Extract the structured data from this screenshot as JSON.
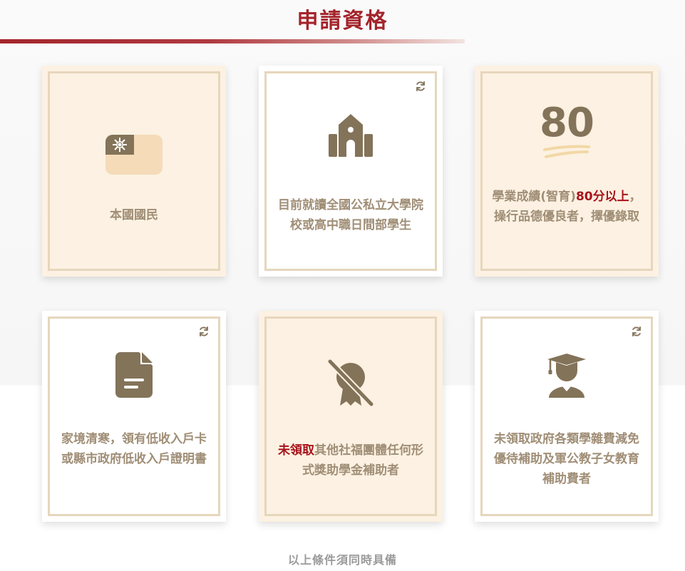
{
  "section": {
    "title": "申請資格",
    "footer_note": "以上條件須同時具備"
  },
  "colors": {
    "accent": "#a4242b",
    "card_beige": "#fcf1e2",
    "frame": "#e6d6bc",
    "icon": "#837359",
    "text": "#a08e76",
    "highlight": "#a8131b"
  },
  "cards": [
    {
      "icon": "taiwan-flag-icon",
      "text": "本國國民"
    },
    {
      "icon": "school-building-icon",
      "text": "目前就讀全國公私立大學院校或高中職日間部學生",
      "flip": "refresh-icon"
    },
    {
      "icon": "score-80-icon",
      "score": "80",
      "text_prefix": "學業成績(智育)",
      "text_highlight": "80分以上",
      "text_suffix": "，操行品德優良者，擇優錄取"
    },
    {
      "icon": "document-icon",
      "text": "家境清寒，領有低收入戶卡或縣市政府低收入戶證明書",
      "flip": "refresh-icon"
    },
    {
      "icon": "no-award-icon",
      "text_highlight": "未領取",
      "text_suffix": "其他社福團體任何形式獎助學金補助者"
    },
    {
      "icon": "graduate-icon",
      "text": "未領取政府各類學雜費減免優待補助及軍公教子女教育補助費者",
      "flip": "refresh-icon"
    }
  ]
}
